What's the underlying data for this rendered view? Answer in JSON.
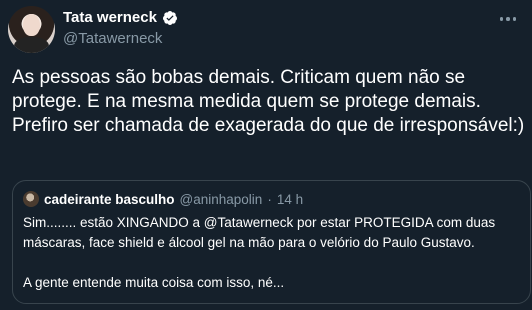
{
  "author": {
    "name": "Tata werneck",
    "handle": "@Tatawerneck",
    "verified": true,
    "avatar_icon": "profile-photo"
  },
  "more_icon": "ellipsis-icon",
  "tweet_text": "As pessoas são bobas demais. Criticam quem não se protege. E na mesma medida quem se protege demais. Prefiro ser chamada de exagerada do que de irresponsável:)",
  "quoted": {
    "name": "cadeirante basculho",
    "handle": "@aninhapolin",
    "separator": "·",
    "time": "14 h",
    "paragraph1": "Sim........ estão XINGANDO a @Tatawerneck por estar PROTEGIDA com duas máscaras, face shield e álcool gel na mão para o velório do Paulo Gustavo.",
    "paragraph2": "A gente entende muita coisa com isso, né..."
  },
  "colors": {
    "background": "#15202b",
    "text": "#ffffff",
    "secondary": "#8899a6",
    "border": "#38444d",
    "verified": "#ffffff"
  }
}
